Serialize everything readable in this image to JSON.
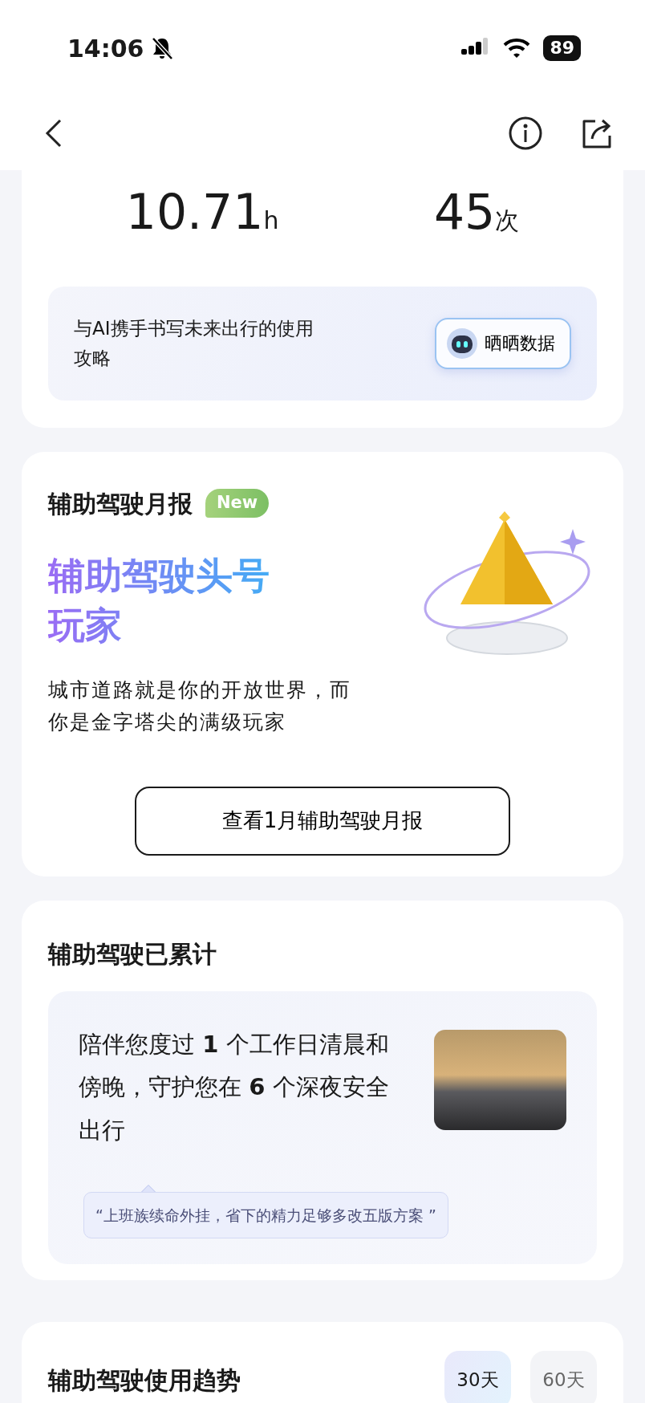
{
  "status_bar": {
    "time": "14:06",
    "battery": "89",
    "silent": true
  },
  "summary": {
    "stats": [
      {
        "value": "10.71",
        "unit": "h"
      },
      {
        "value": "45",
        "unit": "次"
      }
    ],
    "ai_tip": {
      "text": "与AI携手书写未来出行的使用攻略",
      "button": "晒晒数据"
    }
  },
  "monthly_report": {
    "title": "辅助驾驶月报",
    "badge": "New",
    "headline": "辅助驾驶头号玩家",
    "description": "城市道路就是你的开放世界，而你是金字塔尖的满级玩家",
    "button": "查看1月辅助驾驶月报"
  },
  "cumulative": {
    "title": "辅助驾驶已累计",
    "text": "陪伴您度过 **1** 个工作日清晨和傍晚，守护您在 **6** 个深夜安全出行",
    "quote": "“上班族续命外挂，省下的精力足够多改五版方案 ”"
  },
  "trend": {
    "title": "辅助驾驶使用趋势",
    "ranges": [
      {
        "label": "30天",
        "selected": true
      },
      {
        "label": "60天",
        "selected": false
      }
    ]
  }
}
